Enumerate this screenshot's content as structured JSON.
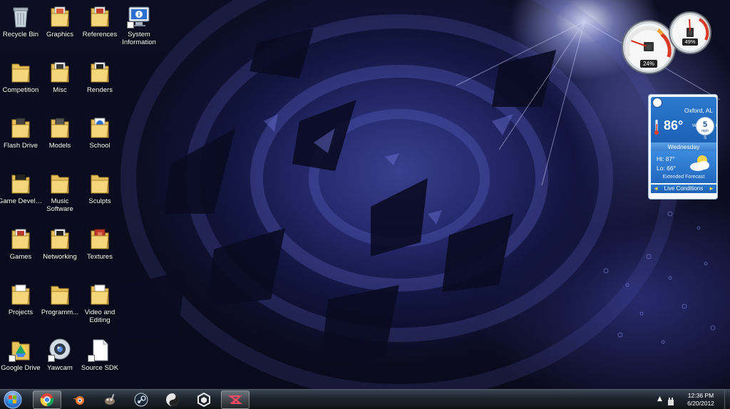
{
  "desktop": {
    "icons": [
      {
        "label": "Recycle Bin",
        "icon": "recycle-bin-icon"
      },
      {
        "label": "Graphics",
        "icon": "folder-icon"
      },
      {
        "label": "References",
        "icon": "folder-icon"
      },
      {
        "label": "System Information",
        "icon": "system-information-icon"
      },
      {
        "label": "Competition",
        "icon": "folder-icon"
      },
      {
        "label": "Misc",
        "icon": "folder-icon"
      },
      {
        "label": "Renders",
        "icon": "folder-icon"
      },
      {
        "label": "Flash Drive",
        "icon": "folder-icon"
      },
      {
        "label": "Models",
        "icon": "folder-icon"
      },
      {
        "label": "School",
        "icon": "folder-icon"
      },
      {
        "label": "Game Developme...",
        "icon": "folder-icon"
      },
      {
        "label": "Music Software",
        "icon": "folder-icon"
      },
      {
        "label": "Sculpts",
        "icon": "folder-icon"
      },
      {
        "label": "Games",
        "icon": "folder-icon"
      },
      {
        "label": "Networking",
        "icon": "folder-icon"
      },
      {
        "label": "Textures",
        "icon": "folder-icon"
      },
      {
        "label": "Projects",
        "icon": "folder-icon"
      },
      {
        "label": "Programm...",
        "icon": "folder-icon"
      },
      {
        "label": "Video and Editing",
        "icon": "folder-icon"
      },
      {
        "label": "Google Drive",
        "icon": "google-drive-icon"
      },
      {
        "label": "Yawcam",
        "icon": "yawcam-icon"
      },
      {
        "label": "Source SDK",
        "icon": "document-icon"
      }
    ]
  },
  "cpu_gadget": {
    "cpu_percent": "24%",
    "memory_percent": "49%",
    "cpu_level": 0.24,
    "memory_level": 0.49
  },
  "weather": {
    "city": "Oxford, AL",
    "temperature": "86°",
    "wind_speed": "5",
    "wind_unit": "mph",
    "compass": {
      "w": "W",
      "e": "E",
      "s": "S"
    },
    "day": "Wednesday",
    "hi": "Hi:  87°",
    "lo": "Lo:  66°",
    "extended_label": "Extended Forecast",
    "live_conditions": "Live Conditions",
    "prev_arrow": "◄",
    "next_arrow": "►"
  },
  "taskbar": {
    "pinned": [
      {
        "name": "chrome",
        "active": true
      },
      {
        "name": "blender",
        "active": false
      },
      {
        "name": "gimp",
        "active": false
      },
      {
        "name": "steam",
        "active": false
      },
      {
        "name": "sculptris",
        "active": false
      },
      {
        "name": "unity",
        "active": false
      },
      {
        "name": "zbrush",
        "active": true
      }
    ],
    "tray_chevron": "▲",
    "time": "12:36 PM",
    "date": "6/20/2012"
  },
  "colors": {
    "folder": "#e8c15a",
    "taskbar": "#1c232c",
    "weather_blue": "#1a5fb4"
  }
}
